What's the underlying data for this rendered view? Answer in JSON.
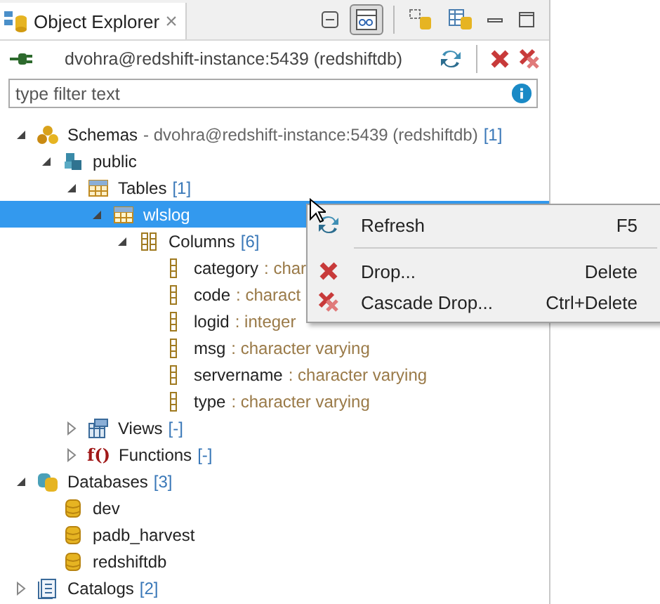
{
  "tab": {
    "title": "Object Explorer",
    "close": "×"
  },
  "toolbar": [
    {
      "kind": "collapse",
      "selected": false
    },
    {
      "kind": "link",
      "selected": true
    },
    {
      "kind": "db-check",
      "selected": false
    },
    {
      "kind": "db-table",
      "selected": false
    },
    {
      "kind": "minimize",
      "selected": false
    },
    {
      "kind": "maximize",
      "selected": false
    }
  ],
  "connection": {
    "label": "dvohra@redshift-instance:5439 (redshiftdb)"
  },
  "filter": {
    "placeholder": "type filter text"
  },
  "tree": [
    {
      "kind": "schemas",
      "label": "Schemas",
      "detail": "- dvohra@redshift-instance:5439 (redshiftdb)",
      "count": "[1]",
      "expanded": true,
      "selected": false,
      "children": [
        {
          "kind": "schema",
          "label": "public",
          "expanded": true,
          "selected": false,
          "children": [
            {
              "kind": "tables",
              "label": "Tables",
              "count": "[1]",
              "expanded": true,
              "selected": false,
              "children": [
                {
                  "kind": "table",
                  "label": "wlslog",
                  "expanded": true,
                  "selected": true,
                  "children": [
                    {
                      "kind": "columns",
                      "label": "Columns",
                      "count": "[6]",
                      "expanded": true,
                      "selected": false,
                      "children": [
                        {
                          "kind": "column",
                          "label": "category",
                          "type": ": char",
                          "selected": false
                        },
                        {
                          "kind": "column",
                          "label": "code",
                          "type": ": charact",
                          "selected": false
                        },
                        {
                          "kind": "column",
                          "label": "logid",
                          "type": ": integer",
                          "selected": false
                        },
                        {
                          "kind": "column",
                          "label": "msg",
                          "type": ": character varying",
                          "selected": false
                        },
                        {
                          "kind": "column",
                          "label": "servername",
                          "type": ": character varying",
                          "selected": false
                        },
                        {
                          "kind": "column",
                          "label": "type",
                          "type": ": character varying",
                          "selected": false
                        }
                      ]
                    }
                  ]
                }
              ]
            },
            {
              "kind": "views",
              "label": "Views",
              "count": "[-]",
              "expanded": false,
              "selected": false
            },
            {
              "kind": "functions",
              "glyph": "f()",
              "label": "Functions",
              "count": "[-]",
              "expanded": false,
              "selected": false
            }
          ]
        }
      ]
    },
    {
      "kind": "databases",
      "label": "Databases",
      "count": "[3]",
      "expanded": true,
      "selected": false,
      "children": [
        {
          "kind": "database",
          "label": "dev",
          "selected": false
        },
        {
          "kind": "database",
          "label": "padb_harvest",
          "selected": false
        },
        {
          "kind": "database",
          "label": "redshiftdb",
          "selected": false
        }
      ]
    },
    {
      "kind": "catalogs",
      "label": "Catalogs",
      "count": "[2]",
      "expanded": false,
      "selected": false
    }
  ],
  "context_menu": [
    {
      "kind": "refresh",
      "label": "Refresh",
      "shortcut": "F5"
    },
    {
      "kind": "separator"
    },
    {
      "kind": "drop",
      "label": "Drop...",
      "shortcut": "Delete"
    },
    {
      "kind": "cascade-drop",
      "label": "Cascade Drop...",
      "shortcut": "Ctrl+Delete"
    }
  ]
}
